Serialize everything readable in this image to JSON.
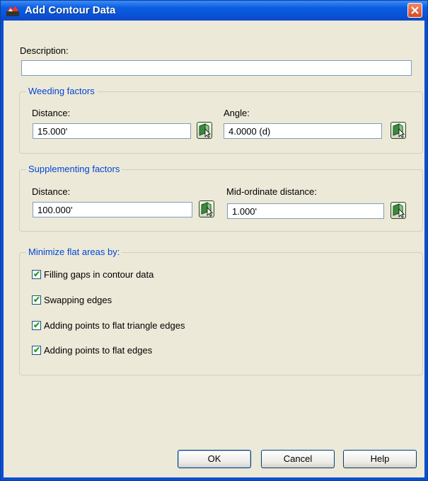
{
  "window": {
    "title": "Add Contour Data"
  },
  "description": {
    "label": "Description:",
    "value": ""
  },
  "weeding": {
    "title": "Weeding factors",
    "distance_label": "Distance:",
    "distance_value": "15.000'",
    "angle_label": "Angle:",
    "angle_value": "4.0000 (d)"
  },
  "supplementing": {
    "title": "Supplementing factors",
    "distance_label": "Distance:",
    "distance_value": "100.000'",
    "midord_label": "Mid-ordinate distance:",
    "midord_value": "1.000'"
  },
  "minimize": {
    "title": "Minimize flat areas by:",
    "options": [
      {
        "label": "Filling gaps in contour data",
        "checked": true
      },
      {
        "label": "Swapping edges",
        "checked": true
      },
      {
        "label": "Adding points to flat triangle edges",
        "checked": true
      },
      {
        "label": "Adding points to flat edges",
        "checked": true
      }
    ]
  },
  "buttons": {
    "ok": "OK",
    "cancel": "Cancel",
    "help": "Help"
  },
  "icons": {
    "app": "civil3d-app-icon",
    "close": "close-icon",
    "pick": "pick-in-drawing-icon",
    "check": "checkmark-icon"
  },
  "colors": {
    "titlebar": "#0a4fd0",
    "group_title": "#0046d5",
    "dialog_bg": "#ece9d8",
    "close_button": "#d64a20"
  }
}
